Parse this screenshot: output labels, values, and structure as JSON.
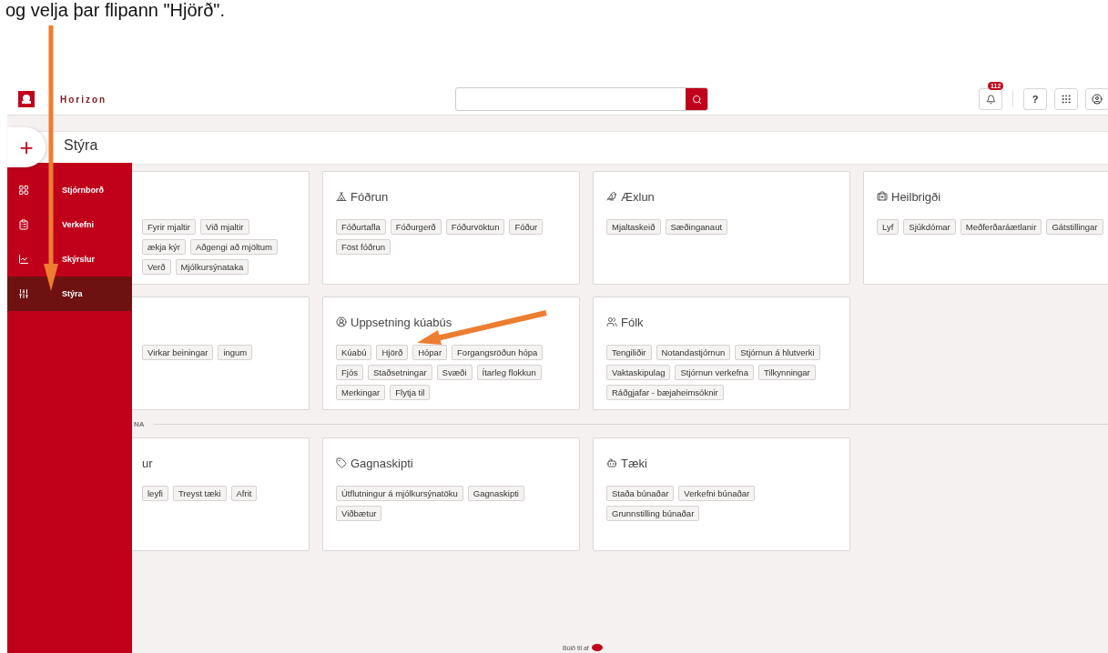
{
  "caption": "og velja þar flipann \"Hjörð\".",
  "header": {
    "logo_text": "Horizon",
    "notification_count": "112",
    "help": "?"
  },
  "add_button": "+",
  "page_title": "Stýra",
  "sidebar": {
    "items": [
      {
        "label": "Stjórnborð",
        "selected": false
      },
      {
        "label": "Verkefni",
        "selected": false
      },
      {
        "label": "Skýrslur",
        "selected": false
      },
      {
        "label": "Stýra",
        "selected": true
      }
    ]
  },
  "sections": [
    {
      "cards": [
        {
          "chips": [
            "Fyrir mjaltir",
            "Við mjaltir",
            "ækja kýr",
            "Aðgengi að mjöltum",
            "Verð",
            "Mjólkursýnataka"
          ]
        },
        {
          "title": "Fóðrun",
          "chips": [
            "Fóðurtafla",
            "Fóðurgerð",
            "Fóðurvöktun",
            "Fóður",
            "Föst fóðrun"
          ]
        },
        {
          "title": "Æxlun",
          "chips": [
            "Mjaltaskeið",
            "Sæðinganaut"
          ]
        },
        {
          "title": "Heilbrigði",
          "chips": [
            "Lyf",
            "Sjúkdómar",
            "Meðferðaráætlanir",
            "Gátstillingar"
          ]
        },
        {
          "chips": [
            "Virkar beiningar",
            "ingum"
          ]
        },
        {
          "title": "Uppsetning kúabús",
          "chips": [
            "Kúabú",
            "Hjörð",
            "Hópar",
            "Forgangsröðun hópa",
            "Fjós",
            "Staðsetningar",
            "Svæði",
            "Ítarleg flokkun",
            "Merkingar",
            "Flytja til"
          ]
        },
        {
          "title": "Fólk",
          "chips": [
            "Tengiliðir",
            "Notandastjórnun",
            "Stjórnun á hlutverki",
            "Vaktaskipulag",
            "Stjórnun verkefna",
            "Tilkynningar",
            "Ráðgjafar - bæjaheimsóknir"
          ]
        }
      ]
    },
    {
      "label": "NA",
      "cards": [
        {
          "title": "ur",
          "chips": [
            "leyfi",
            "Treyst tæki",
            "Afrit"
          ]
        },
        {
          "title": "Gagnaskipti",
          "chips": [
            "Útflutningur á mjólkursýnatöku",
            "Gagnaskipti",
            "Viðbætur"
          ]
        },
        {
          "title": "Tæki",
          "chips": [
            "Staða búnaðar",
            "Verkefni búnaðar",
            "Grunnstilling búnaðar"
          ]
        }
      ]
    }
  ],
  "footer": "Búið til af"
}
